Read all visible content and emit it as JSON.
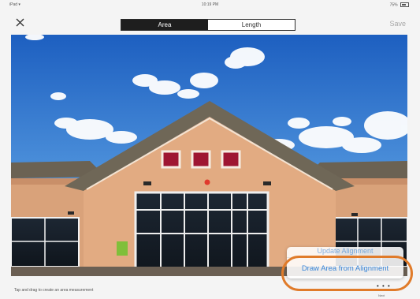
{
  "status_bar": {
    "carrier": "iPad",
    "wifi_icon": "wifi-icon",
    "time": "10:19 PM",
    "battery": "75%",
    "battery_icon": "battery-icon"
  },
  "nav": {
    "close_icon": "close-icon",
    "tabs": [
      {
        "label": "Area",
        "selected": true
      },
      {
        "label": "Length",
        "selected": false
      }
    ],
    "save_label": "Save"
  },
  "photo": {
    "subject": "building-facade-photo",
    "marker_color": "#e0392d"
  },
  "menu": {
    "items": [
      {
        "label": "Update Alignment"
      },
      {
        "label": "Draw Area from Alignment"
      }
    ],
    "highlight_color": "#e07b2a",
    "text_color": "#3a86d8"
  },
  "footer": {
    "hint": "Tap and drag to create an area measurement",
    "dots": "• • •",
    "next_label": "Next"
  }
}
